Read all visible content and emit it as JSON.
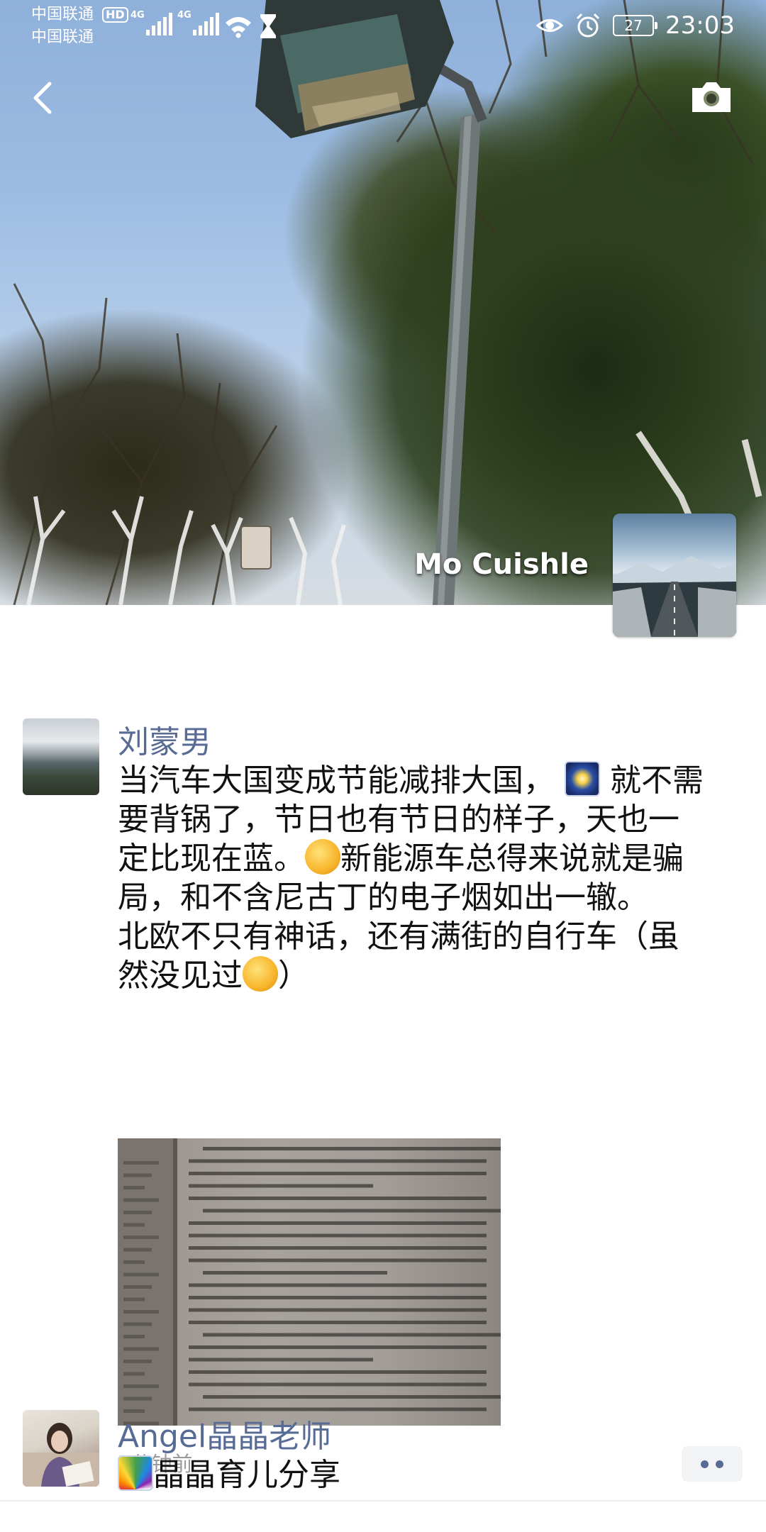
{
  "status_bar": {
    "carrier_1": "中国联通",
    "carrier_2": "中国联通",
    "hd_label": "HD",
    "network_1": "4G",
    "network_2": "4G",
    "battery": "27",
    "time": "23:03",
    "icons": [
      "wifi-icon",
      "hourglass-icon",
      "eye-icon",
      "alarm-icon",
      "battery-icon",
      "signal-icon"
    ]
  },
  "header": {
    "user_name": "Mo Cuishle",
    "back_icon": "back-arrow-icon",
    "camera_icon": "camera-icon"
  },
  "posts": [
    {
      "author": "刘蒙男",
      "lines": [
        "当汽车大国变成节能减排大国，",
        "就不需",
        "要背锅了，节日也有节日的样子，天也一",
        "定比现在蓝。",
        "新能源车总得来说就是骗",
        "局，和不含尼古丁的电子烟如出一辙。",
        "北欧不只有神话，还有满街的自行车（虽",
        "然没见过",
        "）"
      ],
      "emojis": [
        "sparkle-emoji",
        "kiss-emoji",
        "laughing-crying-emoji"
      ],
      "time": "7分钟前",
      "more_icon": "more-dots-icon"
    },
    {
      "author": "Angel晶晶老师",
      "lines": [
        "晶晶育儿分享"
      ],
      "emojis": [
        "rainbow-emoji"
      ]
    }
  ],
  "colors": {
    "link_blue": "#576b95",
    "text": "#111111",
    "muted": "#9a9a9a",
    "more_bg": "#f2f3f5"
  }
}
